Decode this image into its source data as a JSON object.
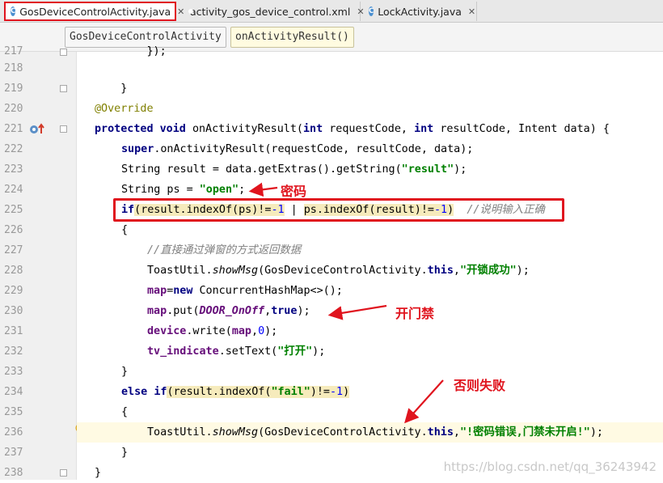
{
  "tabs": [
    {
      "label": "GosDeviceControlActivity.java",
      "close": "✕",
      "kind": "class",
      "active": true
    },
    {
      "label": "activity_gos_device_control.xml",
      "close": "✕",
      "kind": "xml",
      "active": false
    },
    {
      "label": "LockActivity.java",
      "close": "✕",
      "kind": "class",
      "active": false
    }
  ],
  "tab_class_icon_glyph": "C",
  "breadcrumb": {
    "class_name": "GosDeviceControlActivity",
    "method_name": "onActivityResult()"
  },
  "line_numbers": [
    "217",
    "218",
    "219",
    "220",
    "221",
    "222",
    "223",
    "224",
    "225",
    "226",
    "227",
    "228",
    "229",
    "230",
    "231",
    "232",
    "233",
    "234",
    "235",
    "236",
    "237",
    "238"
  ],
  "code": {
    "l217": "        });",
    "l219": "    }",
    "l220_ann": "@Override",
    "l221": {
      "kw1": "protected",
      "kw2": "void",
      "name": "onActivityResult(",
      "kw3": "int",
      "p1": "requestCode, ",
      "kw4": "int",
      "p2": "resultCode, Intent data) {"
    },
    "l222": {
      "kw": "super",
      "rest": ".onActivityResult(requestCode, resultCode, data);"
    },
    "l223": {
      "pre": "String result = data.getExtras().getString(",
      "str": "\"result\"",
      "post": ");"
    },
    "l224": {
      "pre": "String ps = ",
      "str": "\"open\"",
      "post": ";"
    },
    "l225": {
      "kw": "if",
      "paren": "(",
      "a": "result.indexOf(ps)!=",
      "a_num": "-1",
      "op": " | ",
      "b": "ps.indexOf(result)!=",
      "b_num": "-1",
      "close": ")",
      "comment": "//说明输入正确"
    },
    "l226": "{",
    "l227_comment": "//直接通过弹窗的方式返回数据",
    "l228": {
      "cls": "ToastUtil.",
      "method": "showMsg",
      "arg": "(GosDeviceControlActivity.",
      "kw": "this",
      "comma": ",",
      "str": "\"开锁成功\"",
      "end": ");"
    },
    "l229": {
      "fld": "map",
      "eq": "=",
      "kw": "new",
      "rest": " ConcurrentHashMap<>();"
    },
    "l230": {
      "fld": "map",
      "mid": ".put(",
      "const": "DOOR_OnOff",
      "comma": ",",
      "kw": "true",
      "end": ");"
    },
    "l231": {
      "fld": "device",
      "mid": ".write(",
      "fld2": "map",
      "comma": ",",
      "num": "0",
      "end": ");"
    },
    "l232": {
      "fld": "tv_indicate",
      "mid": ".setText(",
      "str": "\"打开\"",
      "end": ");"
    },
    "l233": "}",
    "l234": {
      "kw1": "else",
      "kw2": "if",
      "paren": "(",
      "a": "result.indexOf(",
      "str": "\"fail\"",
      "b": ")!=",
      "num": "-1",
      "close": ")"
    },
    "l235": "{",
    "l236": {
      "cls": "ToastUtil.",
      "method": "showMsg",
      "arg": "(GosDeviceControlActivity.",
      "kw": "this",
      "comma": ",",
      "str": "\"!密码错误,门禁未开启!\"",
      "end": ");"
    },
    "l237": "}",
    "l238": "}"
  },
  "annotations": {
    "password": "密码",
    "open_door": "开门禁",
    "otherwise_fail": "否则失败"
  },
  "watermark": "https://blog.csdn.net/qq_36243942",
  "colors": {
    "annotation_red": "#e0141e",
    "keyword": "#000080",
    "string": "#008000",
    "field": "#660e7a"
  }
}
